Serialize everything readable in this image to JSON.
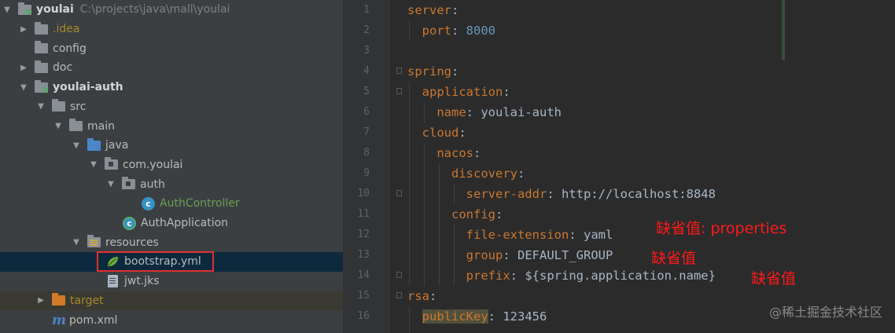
{
  "project_tree": {
    "root": {
      "name": "youlai",
      "path": "C:\\projects\\java\\mall\\youlai"
    },
    "items": [
      {
        "label": "youlai"
      },
      {
        "label": ".idea"
      },
      {
        "label": "config"
      },
      {
        "label": "doc"
      },
      {
        "label": "youlai-auth"
      },
      {
        "label": "src"
      },
      {
        "label": "main"
      },
      {
        "label": "java"
      },
      {
        "label": "com.youlai"
      },
      {
        "label": "auth"
      },
      {
        "label": "AuthController"
      },
      {
        "label": "AuthApplication"
      },
      {
        "label": "resources"
      },
      {
        "label": "bootstrap.yml"
      },
      {
        "label": "jwt.jks"
      },
      {
        "label": "target"
      },
      {
        "label": "pom.xml"
      }
    ]
  },
  "editor": {
    "line_numbers": [
      "1",
      "2",
      "3",
      "4",
      "5",
      "6",
      "7",
      "8",
      "9",
      "10",
      "11",
      "12",
      "13",
      "14",
      "15",
      "16"
    ],
    "lines": [
      {
        "key": "server",
        "punct": ":",
        "value": ""
      },
      {
        "key": "port",
        "punct": ": ",
        "value": "8000"
      },
      {
        "key": "",
        "punct": "",
        "value": ""
      },
      {
        "key": "spring",
        "punct": ":",
        "value": ""
      },
      {
        "key": "application",
        "punct": ":",
        "value": ""
      },
      {
        "key": "name",
        "punct": ": ",
        "value": "youlai-auth"
      },
      {
        "key": "cloud",
        "punct": ":",
        "value": ""
      },
      {
        "key": "nacos",
        "punct": ":",
        "value": ""
      },
      {
        "key": "discovery",
        "punct": ":",
        "value": ""
      },
      {
        "key": "server-addr",
        "punct": ": ",
        "value": "http://localhost:8848"
      },
      {
        "key": "config",
        "punct": ":",
        "value": ""
      },
      {
        "key": "file-extension",
        "punct": ": ",
        "value": "yaml"
      },
      {
        "key": "group",
        "punct": ": ",
        "value": "DEFAULT_GROUP"
      },
      {
        "key": "prefix",
        "punct": ": ",
        "value": "${spring.application.name}"
      },
      {
        "key": "rsa",
        "punct": ":",
        "value": ""
      },
      {
        "key": "publicKey",
        "punct": ": ",
        "value": "123456"
      }
    ]
  },
  "annotations": {
    "file_extension_note": "缺省值: properties",
    "group_note": "缺省值",
    "prefix_note": "缺省值"
  },
  "watermark": "@稀土掘金技术社区",
  "colors": {
    "tree_bg": "#3c3f41",
    "editor_bg": "#2b2b2b",
    "yaml_key": "#cc7832",
    "yaml_value": "#a9b7c6",
    "yaml_number": "#6897bb",
    "annotation": "#ff1a1a",
    "highlight_box": "#e03030"
  }
}
